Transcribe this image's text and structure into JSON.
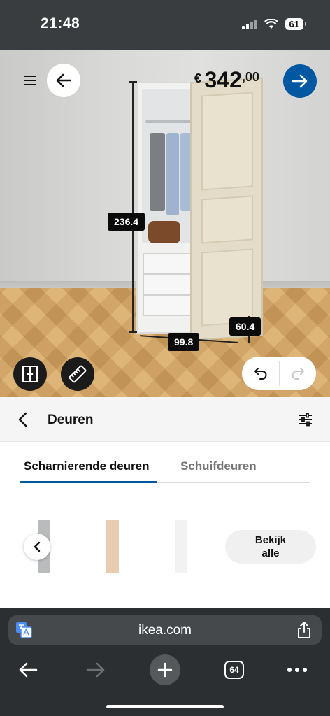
{
  "status": {
    "time": "21:48",
    "battery": "61"
  },
  "configurator": {
    "price": {
      "currency": "€",
      "integer": "342",
      "decimals": ",00"
    },
    "dimensions": {
      "height": "236.4",
      "width": "99.8",
      "depth": "60.4"
    }
  },
  "panel": {
    "title": "Deuren",
    "tabs": [
      {
        "label": "Scharnierende deuren",
        "active": true
      },
      {
        "label": "Schuifdeuren",
        "active": false
      }
    ],
    "see_all_line1": "Bekijk",
    "see_all_line2": "alle",
    "swatch_colors": [
      "#b9bbbd",
      "#e9cdb1",
      "#f2f2f2"
    ]
  },
  "browser": {
    "url": "ikea.com",
    "tabs_count": "64"
  },
  "colors": {
    "accent": "#0058a3",
    "dark_button": "#1b1b1b"
  }
}
